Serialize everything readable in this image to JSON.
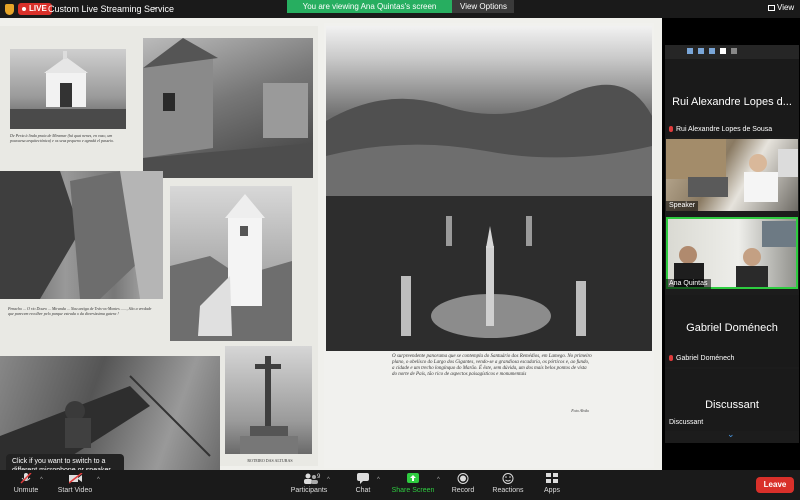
{
  "topbar": {
    "live_label": "LIVE",
    "stream_title": "Custom Live Streaming Service",
    "viewing_text": "You are viewing Ana Quintas's screen",
    "view_options": "View Options",
    "view_label": "View"
  },
  "shared_document": {
    "left_captions": [
      "De Peria à linda praia de Miramar (há quat nenes, en vaso, um pouswesa arquitectónica) e os seus pequeno e agradá el passeio.",
      "Penacho ... O rio Douro ... Miranda ... Nau antiga de Trás-os-Montes ......, São a verdade que parecem recolher pelo parque estrada o da diversíssima gatera !"
    ],
    "small_caption": "ROTEIRO DAS ALTURAS",
    "right_caption": "O surpreendente panorama que se contempla do Santuário dos Remédios, em Lamego. No primeiro plano, o obelisco do Largo dos Gigantes, vendo-se a grandiosa escadaria, os pórticos e, ao fundo, a cidade e um trecho longínquo do Marão. É êste, sem dúvida, um dos mais belos pontos de vista do norte de País, tão rico de aspectos paisagísticos e monumentais",
    "photo_credit": "Foto Alvão"
  },
  "tooltip": {
    "text": "Click if you want to switch to a different microphone or speaker"
  },
  "gallery": {
    "participants": [
      {
        "big_name": "Rui Alexandre Lopes d...",
        "name": "Rui Alexandre Lopes de Sousa",
        "muted": true
      },
      {
        "name": "Speaker",
        "video": true
      },
      {
        "name": "Ana Quintas",
        "video": true,
        "active": true
      },
      {
        "big_name": "Gabriel Doménech",
        "name": "Gabriel Doménech",
        "muted": true
      },
      {
        "big_name": "Discussant",
        "name": "Discussant"
      }
    ],
    "more_label": "..."
  },
  "toolbar": {
    "unmute": "Unmute",
    "start_video": "Start Video",
    "participants": "Participants",
    "participants_count": "9",
    "chat": "Chat",
    "share_screen": "Share Screen",
    "record": "Record",
    "reactions": "Reactions",
    "apps": "Apps",
    "leave": "Leave"
  },
  "colors": {
    "live_red": "#d9302a",
    "viewing_green": "#27ae60",
    "share_green": "#2ecc40",
    "leave_red": "#d9302a",
    "accent_blue": "#1e6fd9"
  }
}
